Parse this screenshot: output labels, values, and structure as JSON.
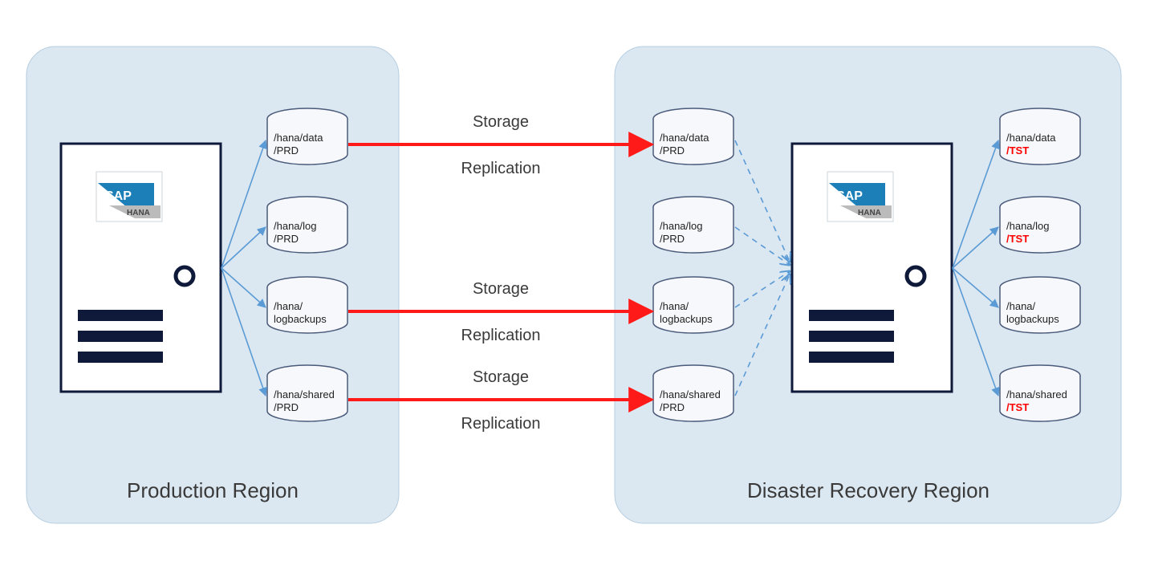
{
  "regions": {
    "production": {
      "label": "Production Region"
    },
    "dr": {
      "label": "Disaster Recovery Region"
    }
  },
  "logo": {
    "brand": "SAP",
    "product": "HANA"
  },
  "replication_label": {
    "line1": "Storage",
    "line2": "Replication"
  },
  "volumes": {
    "prd": {
      "data": {
        "line1": "/hana/data",
        "line2": "/PRD"
      },
      "log": {
        "line1": "/hana/log",
        "line2": "/PRD"
      },
      "logbackups": {
        "line1": "/hana/",
        "line2": "logbackups"
      },
      "shared": {
        "line1": "/hana/shared",
        "line2": "/PRD"
      }
    },
    "dr_prd": {
      "data": {
        "line1": "/hana/data",
        "line2": "/PRD"
      },
      "log": {
        "line1": "/hana/log",
        "line2": "/PRD"
      },
      "logbackups": {
        "line1": "/hana/",
        "line2": "logbackups"
      },
      "shared": {
        "line1": "/hana/shared",
        "line2": "/PRD"
      }
    },
    "tst": {
      "data": {
        "line1": "/hana/data",
        "line2": "/TST"
      },
      "log": {
        "line1": "/hana/log",
        "line2": "/TST"
      },
      "logbackups": {
        "line1": "/hana/",
        "line2": "logbackups"
      },
      "shared": {
        "line1": "/hana/shared",
        "line2": "/TST"
      }
    }
  },
  "colors": {
    "region_bg": "#dce8f1",
    "region_stroke": "#b5cde0",
    "server_stroke": "#0f1a3a",
    "cyl_stroke": "#4a5a7a",
    "arrow_red": "#ff1a1a",
    "arrow_dash": "#5b9bd5",
    "arrow_solid": "#5b9bd5"
  }
}
